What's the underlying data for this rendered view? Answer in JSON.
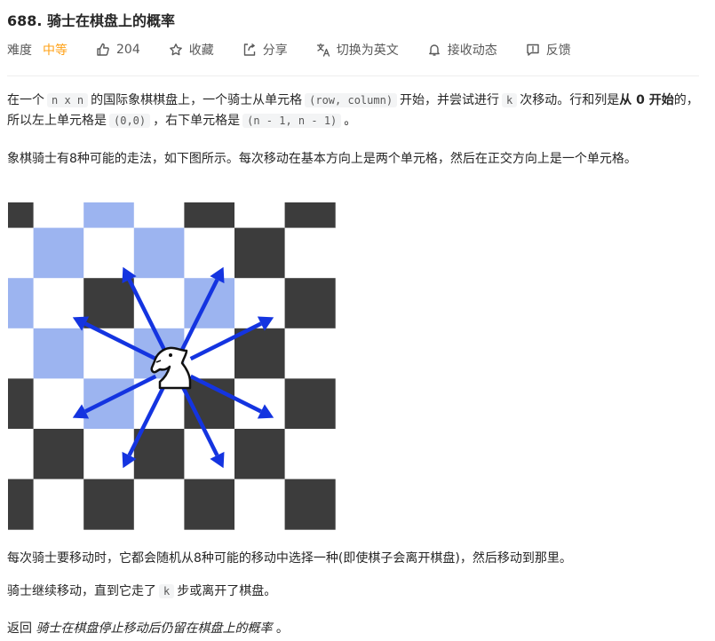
{
  "problem": {
    "title": "688. 骑士在棋盘上的概率"
  },
  "meta": {
    "difficulty_label": "难度",
    "difficulty": "中等",
    "difficulty_color": "#ffa116",
    "likes": "204",
    "favorite": "收藏",
    "share": "分享",
    "translate": "切换为英文",
    "subscribe": "接收动态",
    "feedback": "反馈",
    "icons": [
      "thumbs-up-icon",
      "star-icon",
      "share-icon",
      "translate-icon",
      "bell-icon",
      "feedback-icon"
    ]
  },
  "description": {
    "p1_a": "在一个",
    "p1_code_n": "n x n",
    "p1_b": "的国际象棋棋盘上，一个骑士从单元格",
    "p1_code_rc": "(row, column)",
    "p1_c": "开始，并尝试进行",
    "p1_code_k": "k",
    "p1_d": "次移动。行和列是",
    "p1_bold": "从 0 开始",
    "p1_e": "的，所以左上单元格是",
    "p1_code_00": "(0,0)",
    "p1_f": "，右下单元格是",
    "p1_code_nn": "(n - 1, n - 1)",
    "p1_g": "。",
    "p2": "象棋骑士有8种可能的走法，如下图所示。每次移动在基本方向上是两个单元格，然后在正交方向上是一个单元格。",
    "p3": "每次骑士要移动时，它都会随机从8种可能的移动中选择一种(即使棋子会离开棋盘)，然后移动到那里。",
    "p4_a": "骑士继续移动，直到它走了",
    "p4_code_k": "k",
    "p4_b": "步或离开了棋盘。",
    "p5_a": "返回",
    "p5_em": "骑士在棋盘停止移动后仍留在棋盘上的概率",
    "p5_b": "。"
  },
  "board_image": {
    "dark_color": "#3c3c3c",
    "light_color": "#ffffff",
    "highlight_color": "#9cb4f0",
    "arrow_color": "#1434e0"
  }
}
